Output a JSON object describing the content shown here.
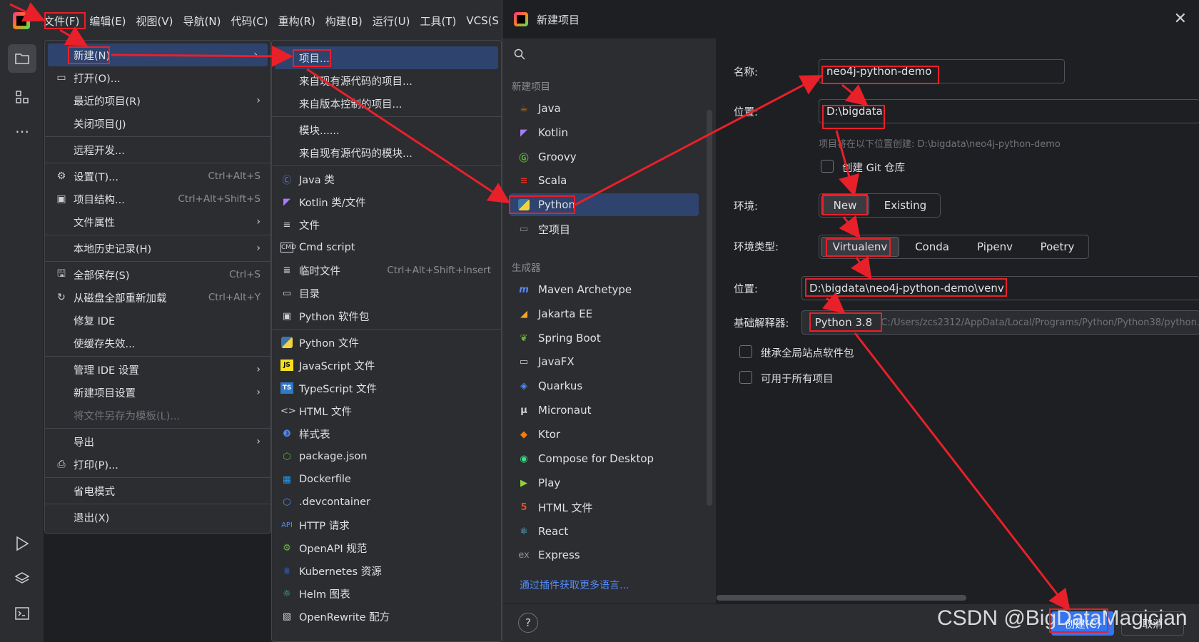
{
  "menubar": {
    "items": [
      "文件(F)",
      "编辑(E)",
      "视图(V)",
      "导航(N)",
      "代码(C)",
      "重构(R)",
      "构建(B)",
      "运行(U)",
      "工具(T)",
      "VCS(S"
    ]
  },
  "file_menu": {
    "items": [
      {
        "label": "新建(N)",
        "icon": "",
        "shortcut": "",
        "arrow": "›"
      },
      {
        "label": "打开(O)...",
        "icon": "folder-icon",
        "shortcut": "",
        "arrow": ""
      },
      {
        "label": "最近的项目(R)",
        "icon": "",
        "shortcut": "",
        "arrow": "›"
      },
      {
        "label": "关闭项目(J)",
        "icon": "",
        "shortcut": "",
        "arrow": ""
      },
      {
        "label": "远程开发...",
        "icon": "",
        "shortcut": "",
        "arrow": ""
      },
      {
        "label": "设置(T)...",
        "icon": "gear-icon",
        "shortcut": "Ctrl+Alt+S",
        "arrow": ""
      },
      {
        "label": "项目结构...",
        "icon": "project-structure-icon",
        "shortcut": "Ctrl+Alt+Shift+S",
        "arrow": ""
      },
      {
        "label": "文件属性",
        "icon": "",
        "shortcut": "",
        "arrow": "›"
      },
      {
        "label": "本地历史记录(H)",
        "icon": "",
        "shortcut": "",
        "arrow": "›"
      },
      {
        "label": "全部保存(S)",
        "icon": "save-icon",
        "shortcut": "Ctrl+S",
        "arrow": ""
      },
      {
        "label": "从磁盘全部重新加载",
        "icon": "reload-icon",
        "shortcut": "Ctrl+Alt+Y",
        "arrow": ""
      },
      {
        "label": "修复 IDE",
        "icon": "",
        "shortcut": "",
        "arrow": ""
      },
      {
        "label": "使缓存失效...",
        "icon": "",
        "shortcut": "",
        "arrow": ""
      },
      {
        "label": "管理 IDE 设置",
        "icon": "",
        "shortcut": "",
        "arrow": "›"
      },
      {
        "label": "新建项目设置",
        "icon": "",
        "shortcut": "",
        "arrow": "›"
      },
      {
        "label": "将文件另存为模板(L)...",
        "icon": "",
        "shortcut": "",
        "arrow": ""
      },
      {
        "label": "导出",
        "icon": "",
        "shortcut": "",
        "arrow": "›"
      },
      {
        "label": "打印(P)...",
        "icon": "print-icon",
        "shortcut": "",
        "arrow": ""
      },
      {
        "label": "省电模式",
        "icon": "",
        "shortcut": "",
        "arrow": ""
      },
      {
        "label": "退出(X)",
        "icon": "",
        "shortcut": "",
        "arrow": ""
      }
    ]
  },
  "new_submenu": {
    "items": [
      {
        "label": "项目...",
        "icon": "",
        "shortcut": ""
      },
      {
        "label": "来自现有源代码的项目...",
        "icon": "",
        "shortcut": ""
      },
      {
        "label": "来自版本控制的项目...",
        "icon": "",
        "shortcut": ""
      },
      {
        "label": "模块......",
        "icon": "",
        "shortcut": ""
      },
      {
        "label": "来自现有源代码的模块...",
        "icon": "",
        "shortcut": ""
      },
      {
        "label": "Java 类",
        "icon": "java-class-icon",
        "shortcut": ""
      },
      {
        "label": "Kotlin 类/文件",
        "icon": "kotlin-icon",
        "shortcut": ""
      },
      {
        "label": "文件",
        "icon": "file-icon",
        "shortcut": ""
      },
      {
        "label": "Cmd script",
        "icon": "cmd-icon",
        "shortcut": ""
      },
      {
        "label": "临时文件",
        "icon": "scratch-file-icon",
        "shortcut": "Ctrl+Alt+Shift+Insert"
      },
      {
        "label": "目录",
        "icon": "directory-icon",
        "shortcut": ""
      },
      {
        "label": "Python 软件包",
        "icon": "python-package-icon",
        "shortcut": ""
      },
      {
        "label": "Python 文件",
        "icon": "python-file-icon",
        "shortcut": ""
      },
      {
        "label": "JavaScript 文件",
        "icon": "javascript-icon",
        "shortcut": ""
      },
      {
        "label": "TypeScript 文件",
        "icon": "typescript-icon",
        "shortcut": ""
      },
      {
        "label": "HTML 文件",
        "icon": "html-icon",
        "shortcut": ""
      },
      {
        "label": "样式表",
        "icon": "css-icon",
        "shortcut": ""
      },
      {
        "label": "package.json",
        "icon": "package-json-icon",
        "shortcut": ""
      },
      {
        "label": "Dockerfile",
        "icon": "docker-icon",
        "shortcut": ""
      },
      {
        "label": ".devcontainer",
        "icon": "devcontainer-icon",
        "shortcut": ""
      },
      {
        "label": "HTTP 请求",
        "icon": "api-icon",
        "shortcut": ""
      },
      {
        "label": "OpenAPI 规范",
        "icon": "openapi-icon",
        "shortcut": ""
      },
      {
        "label": "Kubernetes 资源",
        "icon": "kubernetes-icon",
        "shortcut": ""
      },
      {
        "label": "Helm 图表",
        "icon": "helm-icon",
        "shortcut": ""
      },
      {
        "label": "OpenRewrite 配方",
        "icon": "openrewrite-icon",
        "shortcut": ""
      }
    ]
  },
  "dialog": {
    "title": "新建项目",
    "group_new_project": "新建项目",
    "languages": [
      {
        "label": "Java",
        "icon": "java-icon",
        "color": "#e76f00"
      },
      {
        "label": "Kotlin",
        "icon": "kotlin-icon",
        "color": "#a97bff"
      },
      {
        "label": "Groovy",
        "icon": "groovy-icon",
        "color": "#5fb832"
      },
      {
        "label": "Scala",
        "icon": "scala-icon",
        "color": "#de3423"
      },
      {
        "label": "Python",
        "icon": "python-icon",
        "color": "#3b77a8"
      },
      {
        "label": "空项目",
        "icon": "empty-project-icon",
        "color": "#8c8f94"
      }
    ],
    "group_generators": "生成器",
    "generators": [
      {
        "label": "Maven Archetype",
        "icon": "maven-icon",
        "color": "#548af7"
      },
      {
        "label": "Jakarta EE",
        "icon": "jakarta-icon",
        "color": "#f5a623"
      },
      {
        "label": "Spring Boot",
        "icon": "spring-icon",
        "color": "#6db33f"
      },
      {
        "label": "JavaFX",
        "icon": "javafx-icon",
        "color": "#ced0d6"
      },
      {
        "label": "Quarkus",
        "icon": "quarkus-icon",
        "color": "#548af7"
      },
      {
        "label": "Micronaut",
        "icon": "micronaut-icon",
        "color": "#ced0d6"
      },
      {
        "label": "Ktor",
        "icon": "ktor-icon",
        "color": "#f97a12"
      },
      {
        "label": "Compose for Desktop",
        "icon": "compose-icon",
        "color": "#3ddc84"
      },
      {
        "label": "Play",
        "icon": "play-icon",
        "color": "#92d13d"
      },
      {
        "label": "HTML 文件",
        "icon": "html5-icon",
        "color": "#e44d26"
      },
      {
        "label": "React",
        "icon": "react-icon",
        "color": "#61dafb"
      },
      {
        "label": "Express",
        "icon": "express-icon",
        "color": "#8c8f94"
      }
    ],
    "plugin_link": "通过插件获取更多语言...",
    "name_label": "名称:",
    "name_value": "neo4j-python-demo",
    "location_label": "位置:",
    "location_value": "D:\\bigdata",
    "location_hint": "项目将在以下位置创建: D:\\bigdata\\neo4j-python-demo",
    "git_label": "创建 Git 仓库",
    "env_label": "环境:",
    "env_options": [
      "New",
      "Existing"
    ],
    "env_type_label": "环境类型:",
    "env_type_options": [
      "Virtualenv",
      "Conda",
      "Pipenv",
      "Poetry"
    ],
    "venv_location_label": "位置:",
    "venv_location_value": "D:\\bigdata\\neo4j-python-demo\\venv",
    "interpreter_label": "基础解释器:",
    "interpreter_value": "Python 3.8",
    "interpreter_path": "C:/Users/zcs2312/AppData/Local/Programs/Python/Python38/python.",
    "inherit_label": "继承全局站点软件包",
    "all_projects_label": "可用于所有项目",
    "create_button": "创建(C)",
    "cancel_button": "取消"
  },
  "watermark": "CSDN @BigDataMagician",
  "colors": {
    "annotation": "#e8202a",
    "accent": "#3574f0",
    "selection": "#2e436e"
  }
}
